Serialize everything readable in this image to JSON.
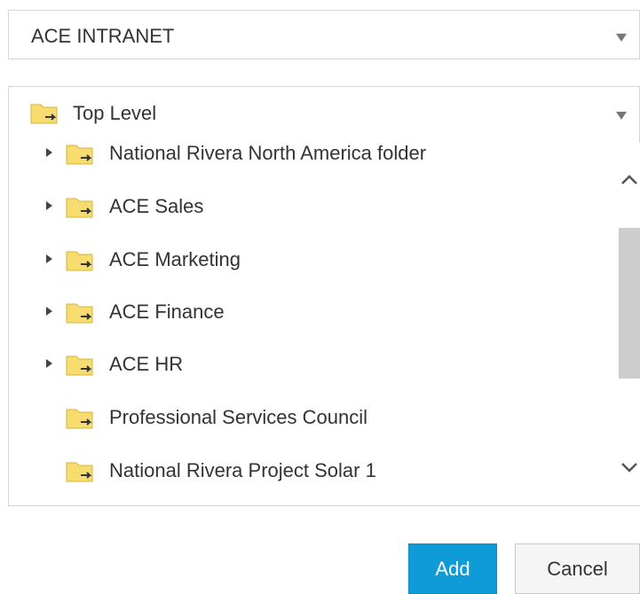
{
  "site_select": {
    "value": "ACE INTRANET"
  },
  "folder_select": {
    "value": "Top Level"
  },
  "tree": {
    "items": [
      {
        "label": "National Rivera North America folder",
        "expandable": true
      },
      {
        "label": "ACE Sales",
        "expandable": true
      },
      {
        "label": "ACE Marketing",
        "expandable": true
      },
      {
        "label": "ACE Finance",
        "expandable": true
      },
      {
        "label": "ACE HR",
        "expandable": true
      },
      {
        "label": "Professional Services Council",
        "expandable": false
      },
      {
        "label": "National Rivera Project Solar 1",
        "expandable": false
      }
    ]
  },
  "actions": {
    "add_label": "Add",
    "cancel_label": "Cancel"
  },
  "colors": {
    "primary": "#0f9bd7",
    "folder": "#f7dc6f",
    "border": "#d6d6d6",
    "scroll_thumb": "#cdcdcd"
  },
  "icons": {
    "folder": "folder-arrow-icon",
    "expander": "expand-arrow-icon",
    "dropdown": "caret-down-icon"
  }
}
